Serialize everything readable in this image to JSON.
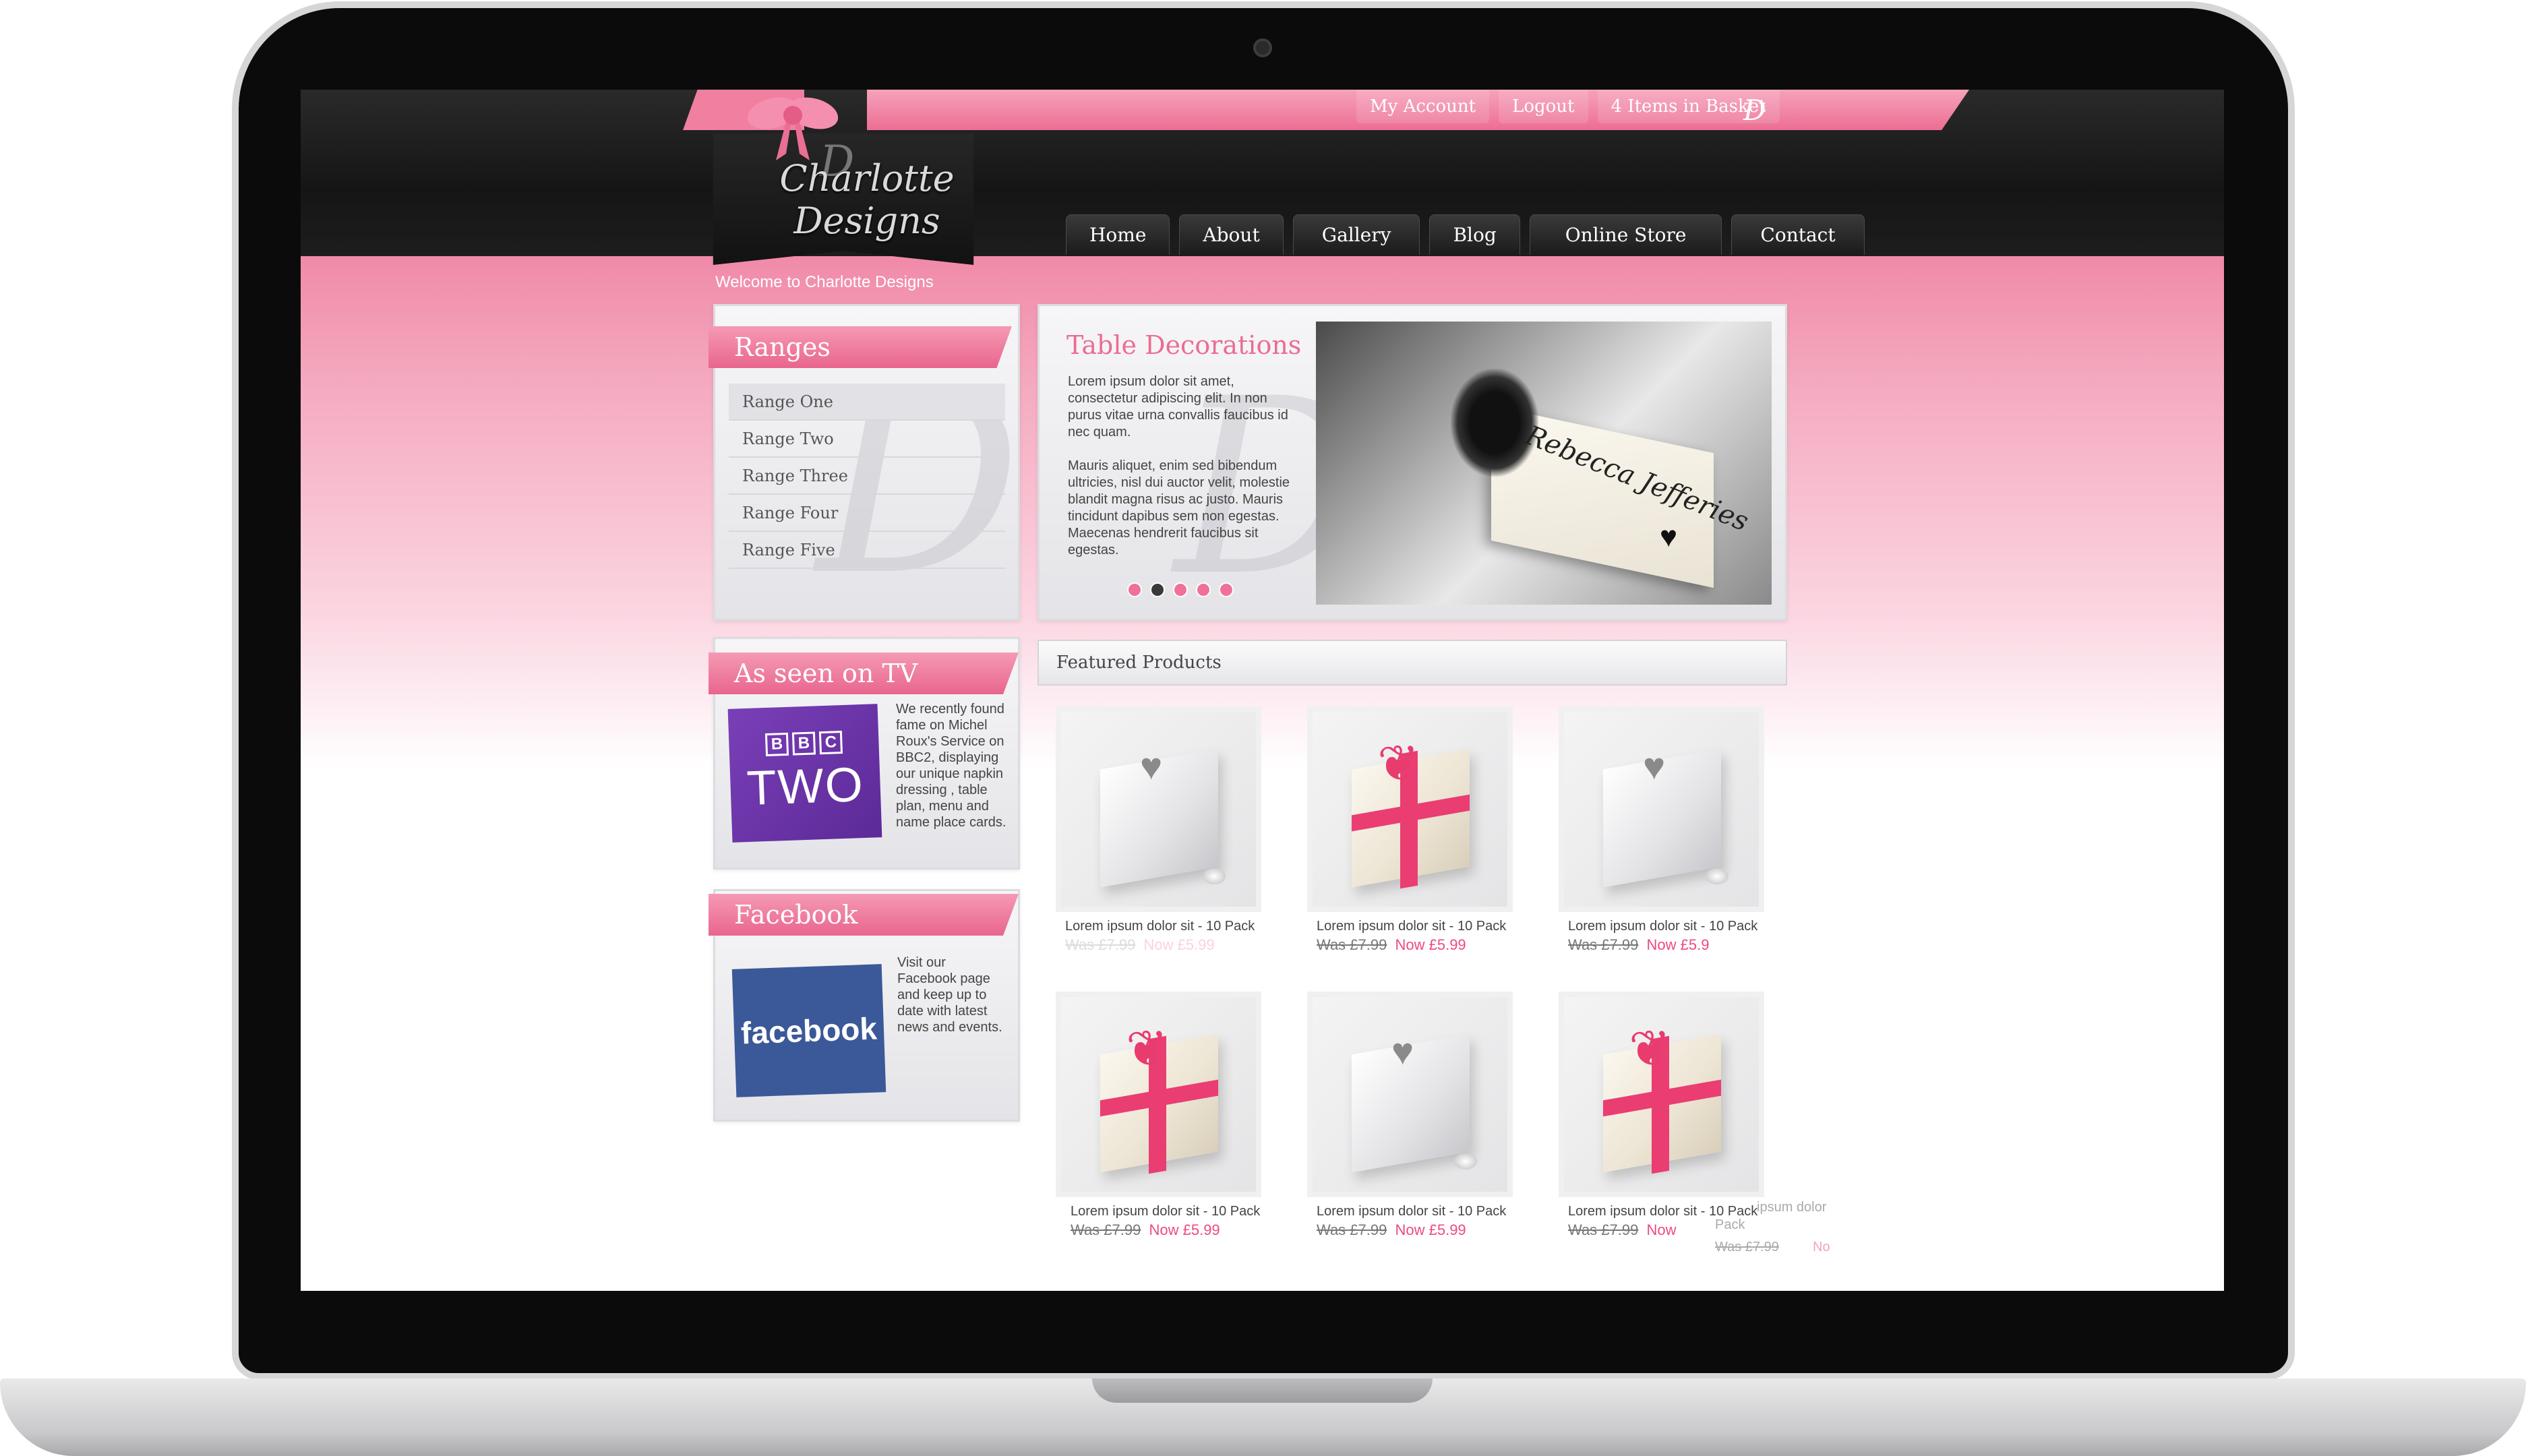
{
  "header": {
    "logo_text": "Charlotte Designs",
    "logo_monogram": "D",
    "top_links": [
      {
        "label": "My Account"
      },
      {
        "label": "Logout"
      },
      {
        "label": "4 Items in Basket"
      }
    ],
    "nav": [
      {
        "label": "Home"
      },
      {
        "label": "About"
      },
      {
        "label": "Gallery"
      },
      {
        "label": "Blog"
      },
      {
        "label": "Online Store"
      },
      {
        "label": "Contact"
      }
    ]
  },
  "welcome": "Welcome to Charlotte Designs",
  "ranges": {
    "title": "Ranges",
    "items": [
      {
        "label": "Range One"
      },
      {
        "label": "Range Two"
      },
      {
        "label": "Range Three"
      },
      {
        "label": "Range Four"
      },
      {
        "label": "Range Five"
      }
    ]
  },
  "tv": {
    "title": "As seen on TV",
    "logo_boxes": [
      "B",
      "B",
      "C"
    ],
    "logo_text": "TWO",
    "text": "We recently found fame on Michel Roux's Service on BBC2, displaying our unique napkin dressing , table plan, menu and name place cards."
  },
  "facebook": {
    "title": "Facebook",
    "logo_text": "facebook",
    "text": "Visit our Facebook page and keep up to date with latest news and events."
  },
  "feature": {
    "title": "Table Decorations",
    "paragraph1": "Lorem ipsum dolor sit amet, consectetur adipiscing elit. In non purus vitae urna convallis faucibus id nec quam.",
    "paragraph2": "Mauris aliquet, enim sed bibendum ultricies, nisl dui auctor velit, molestie blandit magna risus ac justo. Mauris tincidunt dapibus sem non egestas. Maecenas hendrerit faucibus sit egestas.",
    "card_name": "Rebecca Jefferies",
    "slides": 5,
    "active_slide": 2
  },
  "featured": {
    "title": "Featured Products",
    "products": [
      {
        "name": "Lorem ipsum dolor sit - 10 Pack",
        "was": "Was £7.99",
        "now": "Now £5.99",
        "style": "white"
      },
      {
        "name": "Lorem ipsum dolor sit - 10 Pack",
        "was": "Was £7.99",
        "now": "Now £5.99",
        "style": "cream"
      },
      {
        "name": "Lorem ipsum dolor sit - 10 Pack",
        "was": "Was £7.99",
        "now": "Now £5.9",
        "style": "white"
      },
      {
        "name": "Lorem ipsum dolor sit - 10 Pack",
        "was": "Was £7.99",
        "now": "Now £5.99",
        "style": "cream"
      },
      {
        "name": "Lorem ipsum dolor sit - 10 Pack",
        "was": "Was £7.99",
        "now": "Now £5.99",
        "style": "white"
      },
      {
        "name": "Lorem ipsum dolor sit - 10 Pack",
        "was": "Was £7.99",
        "now": "Now",
        "style": "cream"
      }
    ],
    "ghost_text": {
      "name": "ipsum dolor",
      "pack": "Pack",
      "was": "Was £7.99",
      "now": "No"
    }
  },
  "colors": {
    "accent": "#ec6c92",
    "price_now": "#ee4a7e",
    "header_bg": "#1a1a1a",
    "tv_logo": "#6a34a8",
    "facebook_logo": "#3b5998"
  }
}
